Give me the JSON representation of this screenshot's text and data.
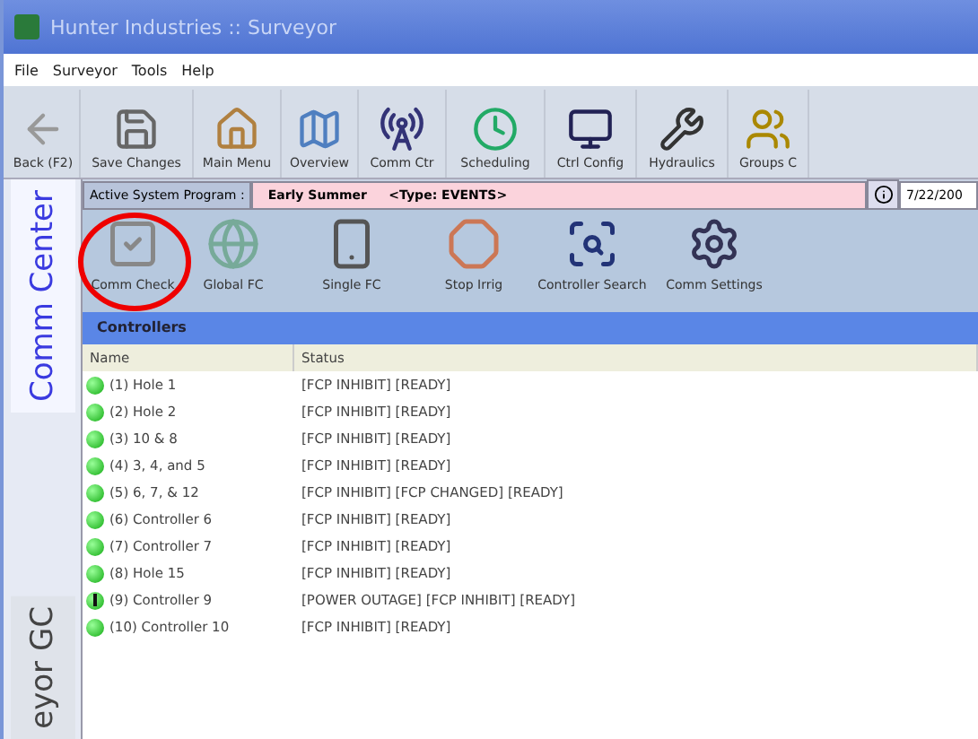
{
  "window": {
    "title": "Hunter Industries :: Surveyor"
  },
  "menu": [
    "File",
    "Surveyor",
    "Tools",
    "Help"
  ],
  "toolbar": [
    {
      "label": "Back (F2)"
    },
    {
      "label": "Save Changes"
    },
    {
      "label": "Main Menu"
    },
    {
      "label": "Overview"
    },
    {
      "label": "Comm Ctr"
    },
    {
      "label": "Scheduling"
    },
    {
      "label": "Ctrl Config"
    },
    {
      "label": "Hydraulics"
    },
    {
      "label": "Groups C"
    }
  ],
  "side_tabs": [
    {
      "label": "Comm Center",
      "selected": true
    },
    {
      "label": "eyor GC",
      "selected": false
    }
  ],
  "program_bar": {
    "label": "Active System Program :",
    "value": "Early Summer     <Type: EVENTS>",
    "date": "7/22/200"
  },
  "actions": [
    {
      "label": "Comm Check",
      "highlighted": true
    },
    {
      "label": "Global FC",
      "highlighted": false
    },
    {
      "label": "Single FC",
      "highlighted": false
    },
    {
      "label": "Stop Irrig",
      "highlighted": false
    },
    {
      "label": "Controller Search",
      "highlighted": false
    },
    {
      "label": "Comm Settings",
      "highlighted": false
    }
  ],
  "controllers": {
    "title": "Controllers",
    "columns": [
      "Name",
      "Status"
    ],
    "rows": [
      {
        "name": "(1)  Hole 1",
        "status": "[FCP INHIBIT] [READY]",
        "warning": false
      },
      {
        "name": "(2)  Hole 2",
        "status": "[FCP INHIBIT] [READY]",
        "warning": false
      },
      {
        "name": "(3)  10 & 8",
        "status": "[FCP INHIBIT] [READY]",
        "warning": false
      },
      {
        "name": "(4)  3, 4, and 5",
        "status": "[FCP INHIBIT] [READY]",
        "warning": false
      },
      {
        "name": "(5)  6, 7, & 12",
        "status": "[FCP INHIBIT] [FCP CHANGED] [READY]",
        "warning": false
      },
      {
        "name": "(6)  Controller 6",
        "status": "[FCP INHIBIT] [READY]",
        "warning": false
      },
      {
        "name": "(7)  Controller 7",
        "status": "[FCP INHIBIT] [READY]",
        "warning": false
      },
      {
        "name": "(8)  Hole 15",
        "status": "[FCP INHIBIT] [READY]",
        "warning": false
      },
      {
        "name": "(9)  Controller 9",
        "status": "[POWER OUTAGE] [FCP INHIBIT] [READY]",
        "warning": true
      },
      {
        "name": "(10)  Controller 10",
        "status": "[FCP INHIBIT] [READY]",
        "warning": false
      }
    ]
  }
}
